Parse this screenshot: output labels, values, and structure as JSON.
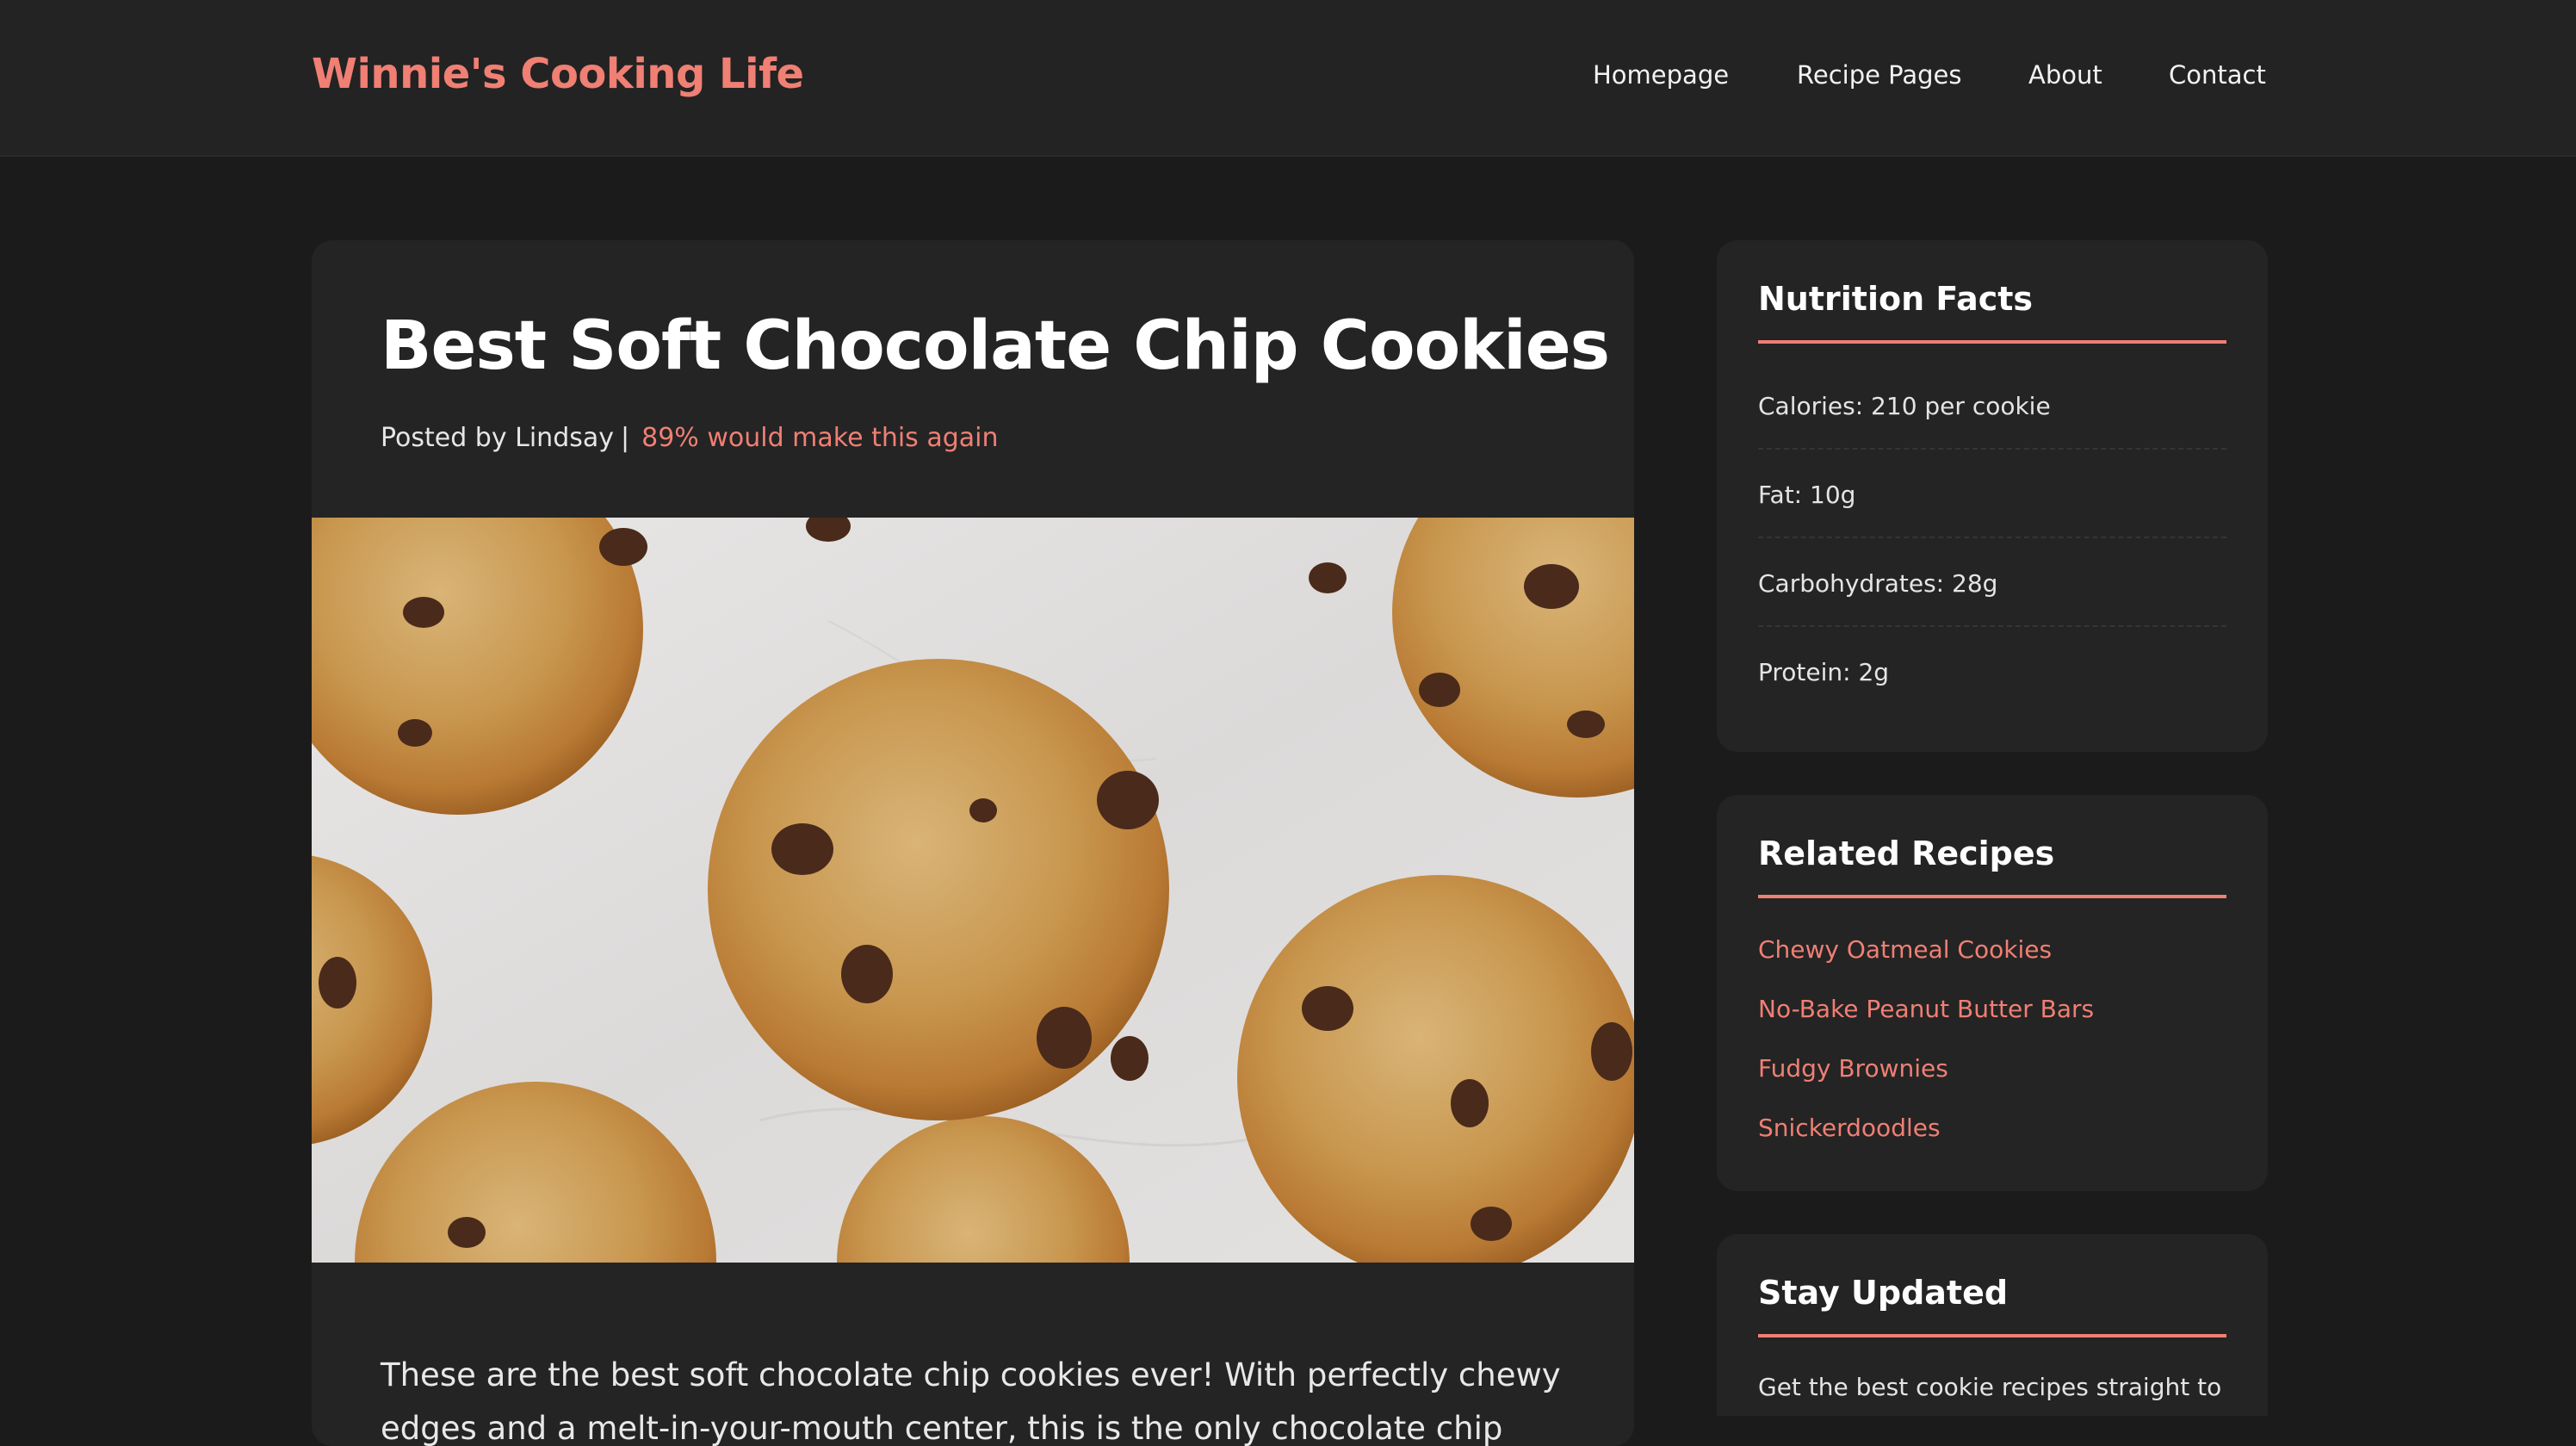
{
  "header": {
    "brand": "Winnie's Cooking Life",
    "nav": [
      "Homepage",
      "Recipe Pages",
      "About",
      "Contact"
    ]
  },
  "post": {
    "title": "Best Soft Chocolate Chip Cookies",
    "author": "Posted by Lindsay",
    "separator": "|",
    "rating": "89% would make this again",
    "intro": "These are the best soft chocolate chip cookies ever! With perfectly chewy edges and a melt-in-your-mouth center, this is the only chocolate chip"
  },
  "sidebar": {
    "nutrition": {
      "title": "Nutrition Facts",
      "items": [
        "Calories: 210 per cookie",
        "Fat: 10g",
        "Carbohydrates: 28g",
        "Protein: 2g"
      ]
    },
    "related": {
      "title": "Related Recipes",
      "items": [
        "Chewy Oatmeal Cookies",
        "No-Bake Peanut Butter Bars",
        "Fudgy Brownies",
        "Snickerdoodles"
      ]
    },
    "newsletter": {
      "title": "Stay Updated",
      "text": "Get the best cookie recipes straight to"
    }
  },
  "colors": {
    "accent": "#f07f74",
    "page_background": "#1b1b1b",
    "card_background": "#242424",
    "header_background": "#232323"
  }
}
